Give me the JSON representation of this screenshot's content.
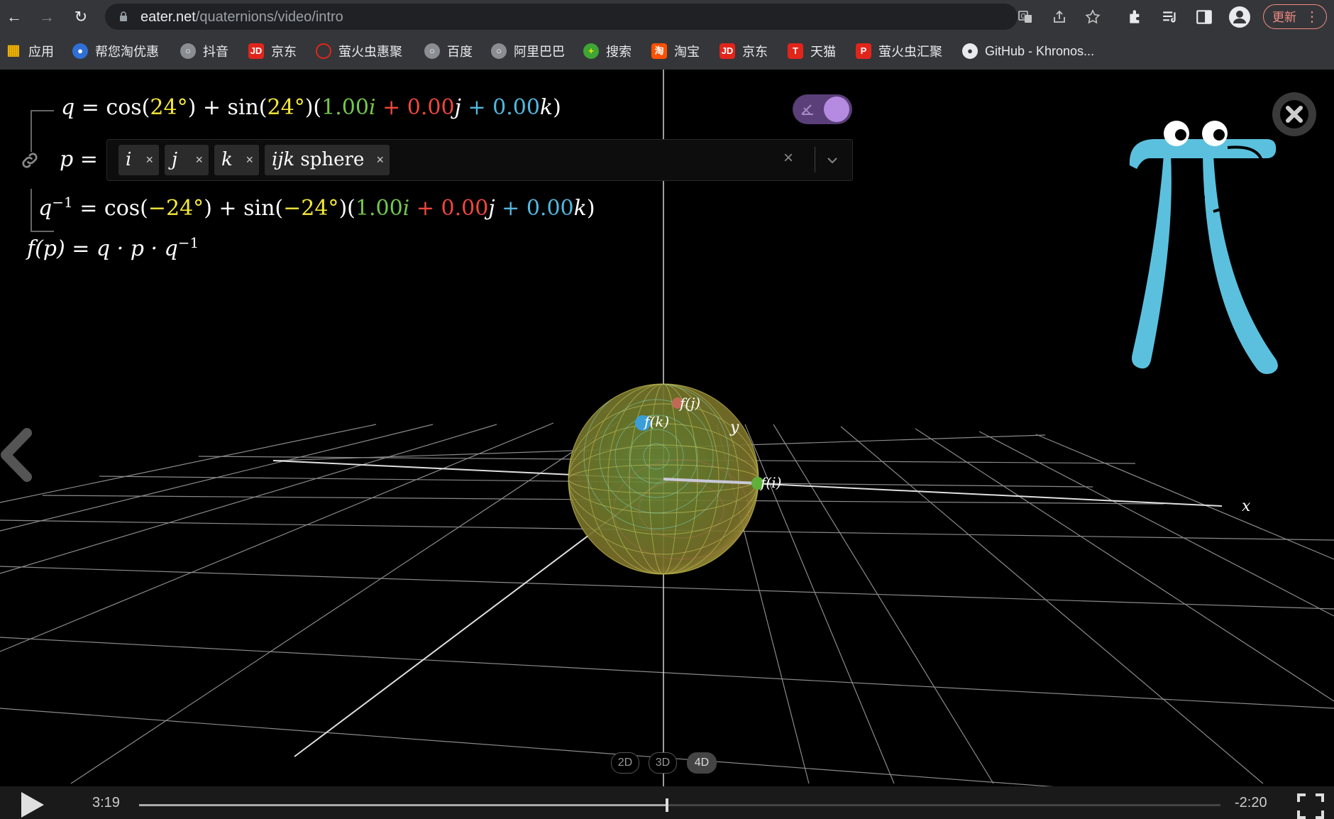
{
  "browser": {
    "url_host": "eater.net",
    "url_path": "/quaternions/video/intro",
    "update_label": "更新",
    "bookmarks": [
      {
        "label": "应用",
        "icon": "apps-grid-icon"
      },
      {
        "label": "帮您淘优惠",
        "icon": "taobao-coupon-icon"
      },
      {
        "label": "抖音",
        "icon": "globe-icon"
      },
      {
        "label": "京东",
        "icon": "jd-icon"
      },
      {
        "label": "萤火虫惠聚",
        "icon": "firefly-icon"
      },
      {
        "label": "百度",
        "icon": "globe-icon"
      },
      {
        "label": "阿里巴巴",
        "icon": "globe-icon"
      },
      {
        "label": "搜索",
        "icon": "search-plus-icon"
      },
      {
        "label": "淘宝",
        "icon": "taobao-icon"
      },
      {
        "label": "京东",
        "icon": "jd-icon"
      },
      {
        "label": "天猫",
        "icon": "tmall-icon"
      },
      {
        "label": "萤火虫汇聚",
        "icon": "firefly-p-icon"
      },
      {
        "label": "GitHub - Khronos...",
        "icon": "github-icon"
      }
    ]
  },
  "equations": {
    "q": {
      "lhs": "q",
      "angle": "24°",
      "a": "1.00",
      "b": "0.00",
      "c": "0.00"
    },
    "p_label": "p",
    "qinv": {
      "angle": "−24°",
      "a": "1.00",
      "b": "0.00",
      "c": "0.00"
    },
    "f": "f(p) = q · p · q"
  },
  "chips": [
    {
      "label": "i"
    },
    {
      "label": "j"
    },
    {
      "label": "k"
    },
    {
      "label": "ijk",
      "suffix": " sphere"
    }
  ],
  "scene": {
    "axis_labels": {
      "x": "x",
      "y": "y"
    },
    "point_labels": {
      "fi": "f(i)",
      "fj": "f(j)",
      "fk": "f(k)"
    }
  },
  "dimension_buttons": [
    "2D",
    "3D",
    "4D"
  ],
  "active_dimension": "4D",
  "player": {
    "current_time": "3:19",
    "remaining_time": "-2:20",
    "progress": 0.488
  },
  "colors": {
    "yellow": "#f5e83b",
    "green": "#73c94a",
    "red": "#f0473d",
    "cyan": "#52b8e0",
    "pi_creature": "#5bc0de"
  }
}
